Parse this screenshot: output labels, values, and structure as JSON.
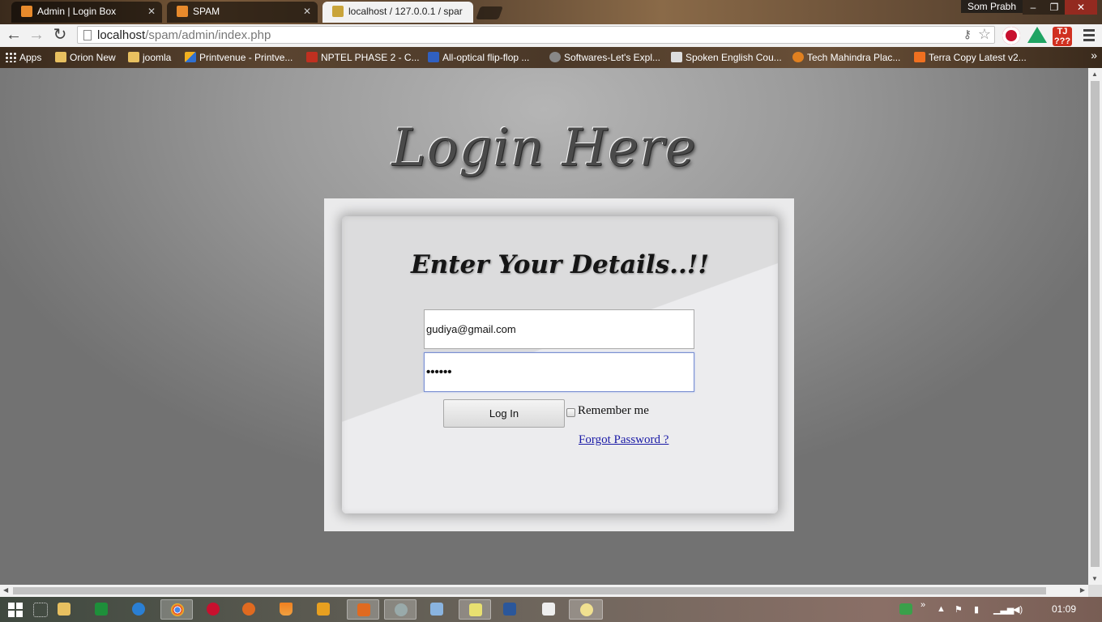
{
  "browser": {
    "tabs": [
      {
        "title": "Admin | Login Box",
        "active": false
      },
      {
        "title": "SPAM",
        "active": false
      },
      {
        "title": "localhost / 127.0.0.1 / spar",
        "active": true
      }
    ],
    "profile_name": "Som Prabh",
    "window_controls": {
      "minimize": "–",
      "maximize": "❐",
      "close": "✕"
    },
    "url_host": "localhost",
    "url_path": "/spam/admin/index.php",
    "ext_badge": "TJ\n???",
    "bookmarks": [
      {
        "label": "Apps",
        "icon": "apps-grid-icon"
      },
      {
        "label": "Orion New",
        "icon": "folder-icon"
      },
      {
        "label": "joomla",
        "icon": "folder-icon"
      },
      {
        "label": "Printvenue - Printve...",
        "icon": "printvenue-icon"
      },
      {
        "label": "NPTEL PHASE 2 - C...",
        "icon": "nptel-icon"
      },
      {
        "label": "All-optical flip-flop ...",
        "icon": "site-icon"
      },
      {
        "label": "Softwares-Let's Expl...",
        "icon": "site-icon"
      },
      {
        "label": "Spoken English Cou...",
        "icon": "page-icon"
      },
      {
        "label": "Tech Mahindra Plac...",
        "icon": "site-icon"
      },
      {
        "label": "Terra Copy Latest v2...",
        "icon": "blogger-icon"
      }
    ]
  },
  "page": {
    "heading": "Login Here",
    "card_title": "Enter Your Details..!!",
    "email_value": "gudiya@gmail.com",
    "password_value": "••••••",
    "login_button": "Log In",
    "remember_label": "Remember me",
    "forgot_link": "Forgot Password ?"
  },
  "taskbar": {
    "clock": "01:09"
  },
  "colors": {
    "page_background": "#8a8a8a",
    "card_background": "#e6e6e8",
    "link": "#1a1aa6",
    "focus_border": "#7a8fd0"
  }
}
